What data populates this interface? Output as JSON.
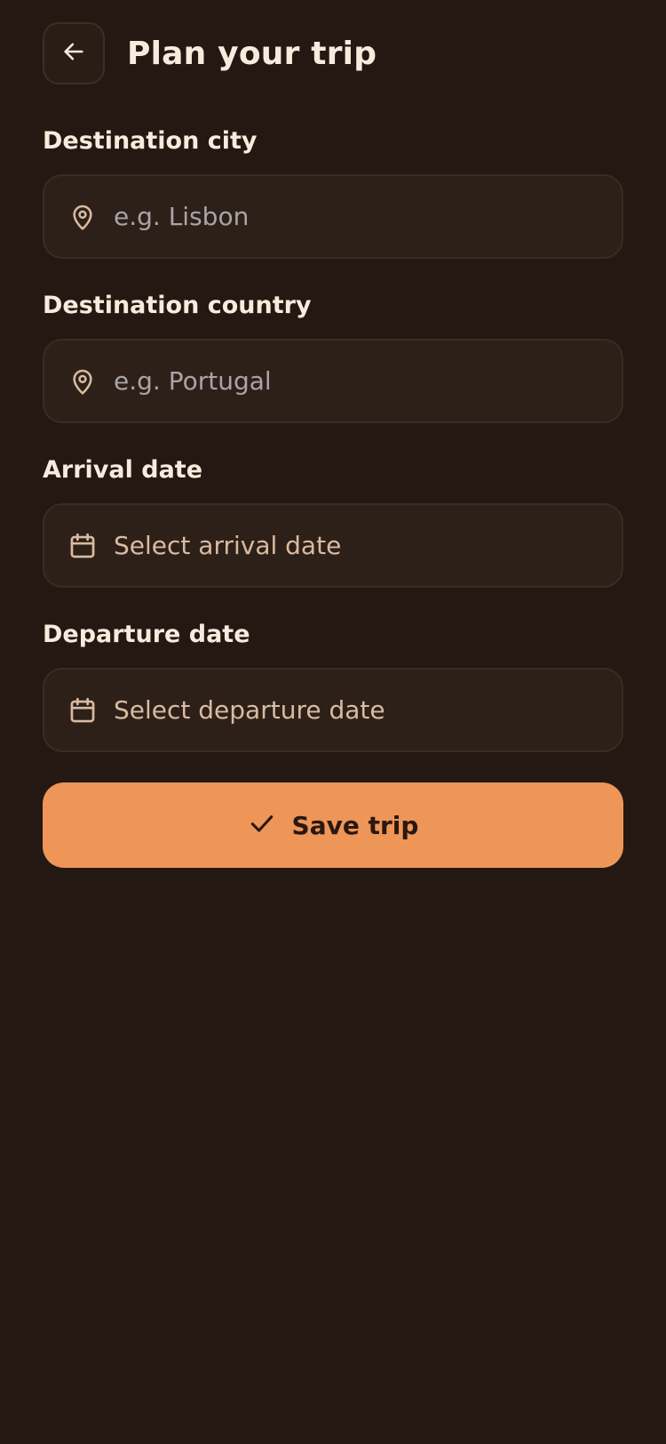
{
  "header": {
    "title": "Plan your trip",
    "back_icon": "arrow-left-icon"
  },
  "form": {
    "destination_city": {
      "label": "Destination city",
      "placeholder": "e.g. Lisbon",
      "icon": "map-pin-icon"
    },
    "destination_country": {
      "label": "Destination country",
      "placeholder": "e.g. Portugal",
      "icon": "map-pin-icon"
    },
    "arrival_date": {
      "label": "Arrival date",
      "placeholder": "Select arrival date",
      "icon": "calendar-icon"
    },
    "departure_date": {
      "label": "Departure date",
      "placeholder": "Select departure date",
      "icon": "calendar-icon"
    }
  },
  "save_button": {
    "label": "Save trip",
    "icon": "check-icon"
  },
  "colors": {
    "background": "#231812",
    "field_background": "#2d2019",
    "accent": "#ee9558",
    "icon": "#d9bba1",
    "text": "#f8ebdd"
  }
}
